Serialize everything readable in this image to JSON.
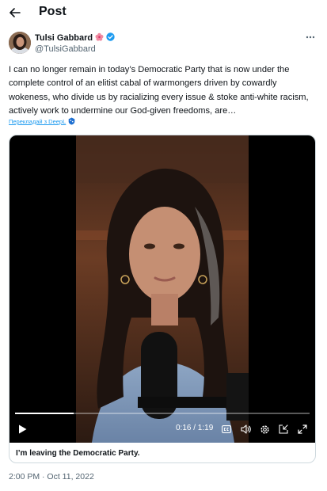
{
  "header": {
    "title": "Post",
    "back_icon": "arrow-left-icon"
  },
  "author": {
    "display_name": "Tulsi Gabbard",
    "handle": "@TulsiGabbard",
    "emoji_icon": "hibiscus-icon",
    "verified_icon": "verified-badge-icon",
    "verified_color": "#1d9bf0"
  },
  "tweet": {
    "text": "I can no longer remain in today’s Democratic Party that is now under the complete control of an elitist cabal of warmongers driven by cowardly wokeness, who divide us by racializing every issue & stoke anti-white racism, actively work to undermine our God-given freedoms, are…",
    "translate_label": "Перекладай з DeepL",
    "translate_icon": "deepl-shield-icon"
  },
  "video": {
    "time_label": "0:16 / 1:19",
    "progress": 0.2,
    "caption": "I’m leaving the Democratic Party.",
    "controls": [
      "play-icon",
      "closed-captions-icon",
      "volume-icon",
      "settings-icon",
      "picture-in-picture-icon",
      "fullscreen-icon"
    ]
  },
  "timestamp": "2:00 PM · Oct 11, 2022",
  "colors": {
    "text": "#0f1419",
    "secondary": "#536471",
    "accent": "#1d9bf0",
    "border": "#cfd9de"
  }
}
